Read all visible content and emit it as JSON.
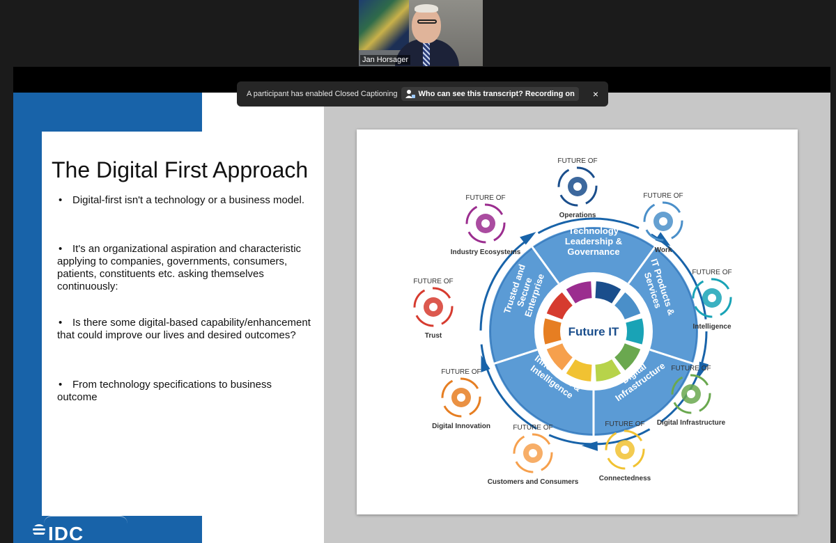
{
  "participant": {
    "name": "Jan Horsager"
  },
  "captions": {
    "notice": "A participant has enabled Closed Captioning",
    "transcript_label": "Who can see this transcript? Recording on",
    "close_symbol": "×"
  },
  "slide": {
    "title": "The Digital First Approach",
    "bullets": [
      "Digital-first isn't a technology or a business model.",
      "It's an organizational aspiration and characteristic applying to companies, governments, consumers, patients, constituents etc. asking  themselves continuously:",
      "Is there some digital-based capability/enhancement that could improve our lives  and desired outcomes?",
      "From technology specifications to business outcome"
    ],
    "bullet_symbol": "•",
    "logo": "IDC"
  },
  "diagram": {
    "center": "Future IT",
    "segments": [
      "Technology Leadership & Governance",
      "IT Products & Services",
      "Digital Infrastructure",
      "Innovation & Intelligence",
      "Trusted and Secure Enterprise"
    ],
    "future_of_label": "FUTURE OF",
    "satellites": [
      {
        "label": "Operations",
        "color": "#1a4e8c",
        "icon": "gears-icon"
      },
      {
        "label": "Work",
        "color": "#4a8fc9",
        "icon": "people-icon"
      },
      {
        "label": "Intelligence",
        "color": "#19a3b6",
        "icon": "brain-gear-icon"
      },
      {
        "label": "Digital Infrastructure",
        "color": "#6aa84f",
        "icon": "circuit-icon"
      },
      {
        "label": "Connectedness",
        "color": "#f1c232",
        "icon": "wifi-icon"
      },
      {
        "label": "Customers and Consumers",
        "color": "#f6a04d",
        "icon": "touch-icon"
      },
      {
        "label": "Digital Innovation",
        "color": "#e67e22",
        "icon": "brain-icon"
      },
      {
        "label": "Trust",
        "color": "#d63b2f",
        "icon": "handshake-icon"
      },
      {
        "label": "Industry Ecosystems",
        "color": "#9b2d8f",
        "icon": "hexagons-icon"
      }
    ],
    "ring_colors": [
      "#1a4e8c",
      "#4a8fc9",
      "#19a3b6",
      "#6aa84f",
      "#b7d34a",
      "#f1c232",
      "#f6a04d",
      "#e67e22",
      "#d63b2f",
      "#9b2d8f"
    ]
  }
}
